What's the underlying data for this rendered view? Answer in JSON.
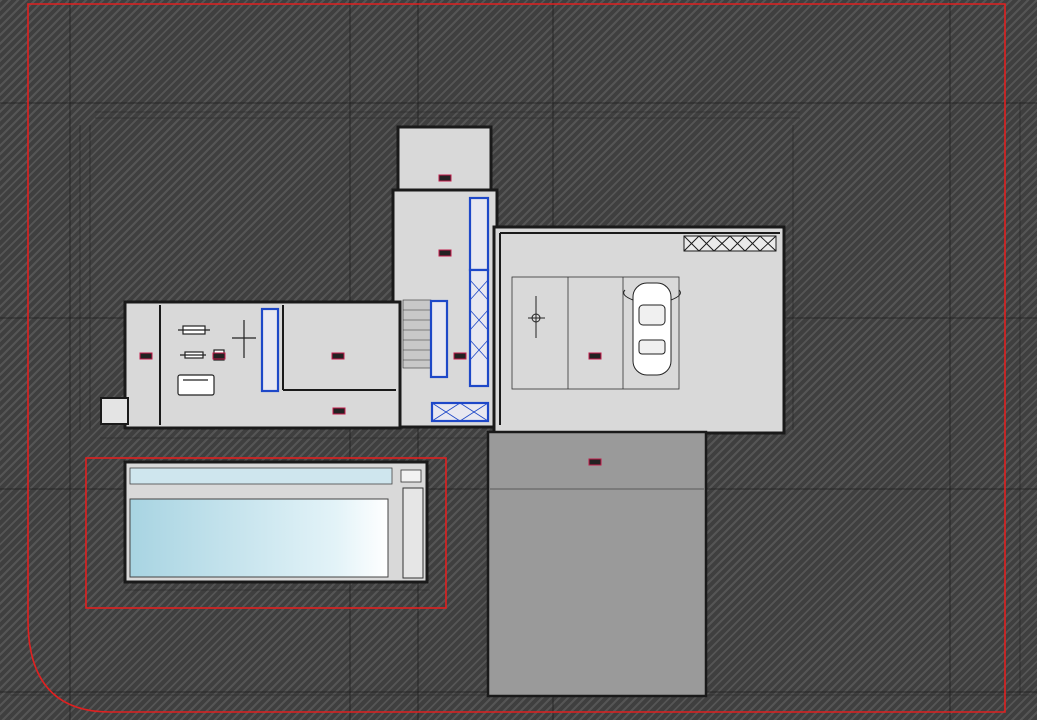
{
  "drawing": {
    "colors": {
      "hatch": "#4a4a4a",
      "wall": "#1a1a1a",
      "floor": "#d9d9d9",
      "boundary": "#e02020",
      "door_frame": "#1e48c8",
      "pool_water": "#b8dce8",
      "ramp": "#9a9a9a",
      "room_tag": "#c21a4a"
    },
    "room_tags": [
      {
        "id": "landing"
      },
      {
        "id": "store"
      },
      {
        "id": "gym"
      },
      {
        "id": "room"
      },
      {
        "id": "hall"
      },
      {
        "id": "garage"
      },
      {
        "id": "room-2"
      },
      {
        "id": "corridor"
      },
      {
        "id": "ramp"
      }
    ],
    "icons": [
      "stair-icon",
      "car-icon",
      "gym-equipment-icon",
      "north-arrow-icon",
      "pool-icon"
    ]
  }
}
